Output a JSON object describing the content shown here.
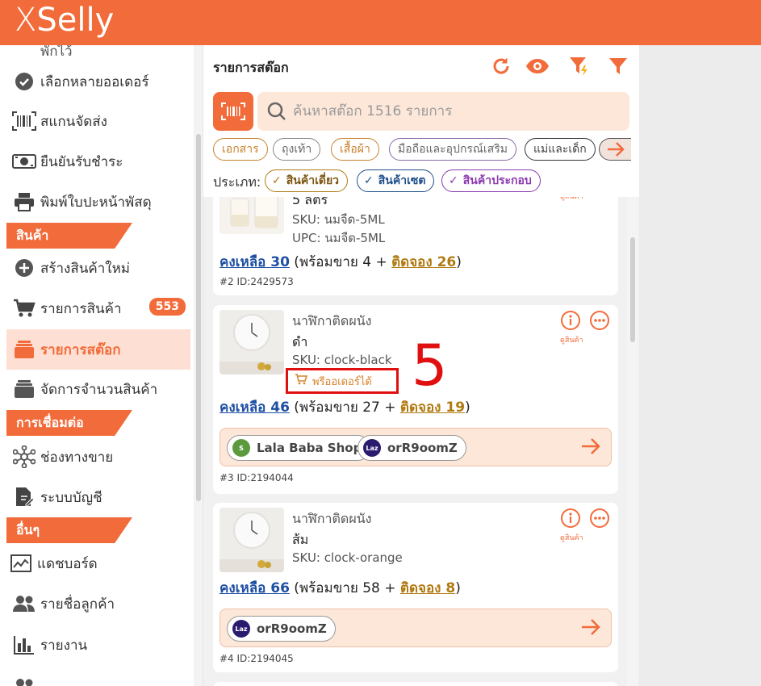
{
  "app": {
    "logo_x": "X",
    "logo_rest": "Selly"
  },
  "sidebar": {
    "items": [
      {
        "label": "พักไว้",
        "icon": "pause-icon"
      },
      {
        "label": "เลือกหลายออเดอร์",
        "icon": "check-circle-icon"
      },
      {
        "label": "สแกนจัดส่ง",
        "icon": "barcode-icon"
      },
      {
        "label": "ยืนยันรับชำระ",
        "icon": "money-icon"
      },
      {
        "label": "พิมพ์ใบปะหน้าพัสดุ",
        "icon": "printer-icon"
      },
      {
        "label": "สร้างสินค้าใหม่",
        "icon": "plus-circle-icon"
      },
      {
        "label": "รายการสินค้า",
        "icon": "cart-icon",
        "badge": "553"
      },
      {
        "label": "รายการสต๊อก",
        "icon": "stack-icon"
      },
      {
        "label": "จัดการจำนวนสินค้า",
        "icon": "layers-icon"
      },
      {
        "label": "ช่องทางขาย",
        "icon": "network-icon"
      },
      {
        "label": "ระบบบัญชี",
        "icon": "document-edit-icon"
      },
      {
        "label": "แดชบอร์ด",
        "icon": "chart-line-icon"
      },
      {
        "label": "รายชื่อลูกค้า",
        "icon": "users-icon"
      },
      {
        "label": "รายงาน",
        "icon": "bar-chart-icon"
      }
    ],
    "sections": {
      "product": "สินค้า",
      "connect": "การเชื่อมต่อ",
      "other": "อื่นๆ"
    }
  },
  "header": {
    "title": "รายการสต๊อก"
  },
  "search": {
    "placeholder": "ค้นหาสต๊อก 1516 รายการ"
  },
  "categories": [
    "เอกสาร",
    "ถุงเท้า",
    "เสื้อผ้า",
    "มือถือและอุปกรณ์เสริม",
    "แม่และเด็ก"
  ],
  "types": {
    "label": "ประเภท:",
    "single": "สินค้าเดี่ยว",
    "set": "สินค้าเซต",
    "combo": "สินค้าประกอบ"
  },
  "cards": [
    {
      "variant": "5 ลิตร",
      "sku": "SKU: นมจืด-5ML",
      "upc": "UPC: นมจืด-5ML",
      "remain": "คงเหลือ 30",
      "ready": " (พร้อมขาย 4 + ",
      "reserved": "ติดจอง 26",
      "close": ")",
      "id": "#2  ID:2429573",
      "view": "ดูสินค้า"
    },
    {
      "name": "นาฬิกาติดผนัง",
      "variant": "ดำ",
      "sku": "SKU: clock-black",
      "preorder": "พรีออเดอร์ได้",
      "remain": "คงเหลือ 46",
      "ready": " (พร้อมขาย 27 + ",
      "reserved": "ติดจอง 19",
      "close": ")",
      "channels": [
        "Lala Baba Shop",
        "orR9oomZ"
      ],
      "id": "#3  ID:2194044",
      "view": "ดูสินค้า"
    },
    {
      "name": "นาฬิกาติดผนัง",
      "variant": "ส้ม",
      "sku": "SKU: clock-orange",
      "remain": "คงเหลือ 66",
      "ready": " (พร้อมขาย 58 + ",
      "reserved": "ติดจอง 8",
      "close": ")",
      "channels": [
        "orR9oomZ"
      ],
      "id": "#4  ID:2194045",
      "view": "ดูสินค้า"
    }
  ],
  "annotation": {
    "step": "5"
  },
  "colors": {
    "brand": "#f26b3a",
    "remain": "#1e4fa3",
    "reserved": "#b07a12",
    "annotation": "#e01010"
  }
}
